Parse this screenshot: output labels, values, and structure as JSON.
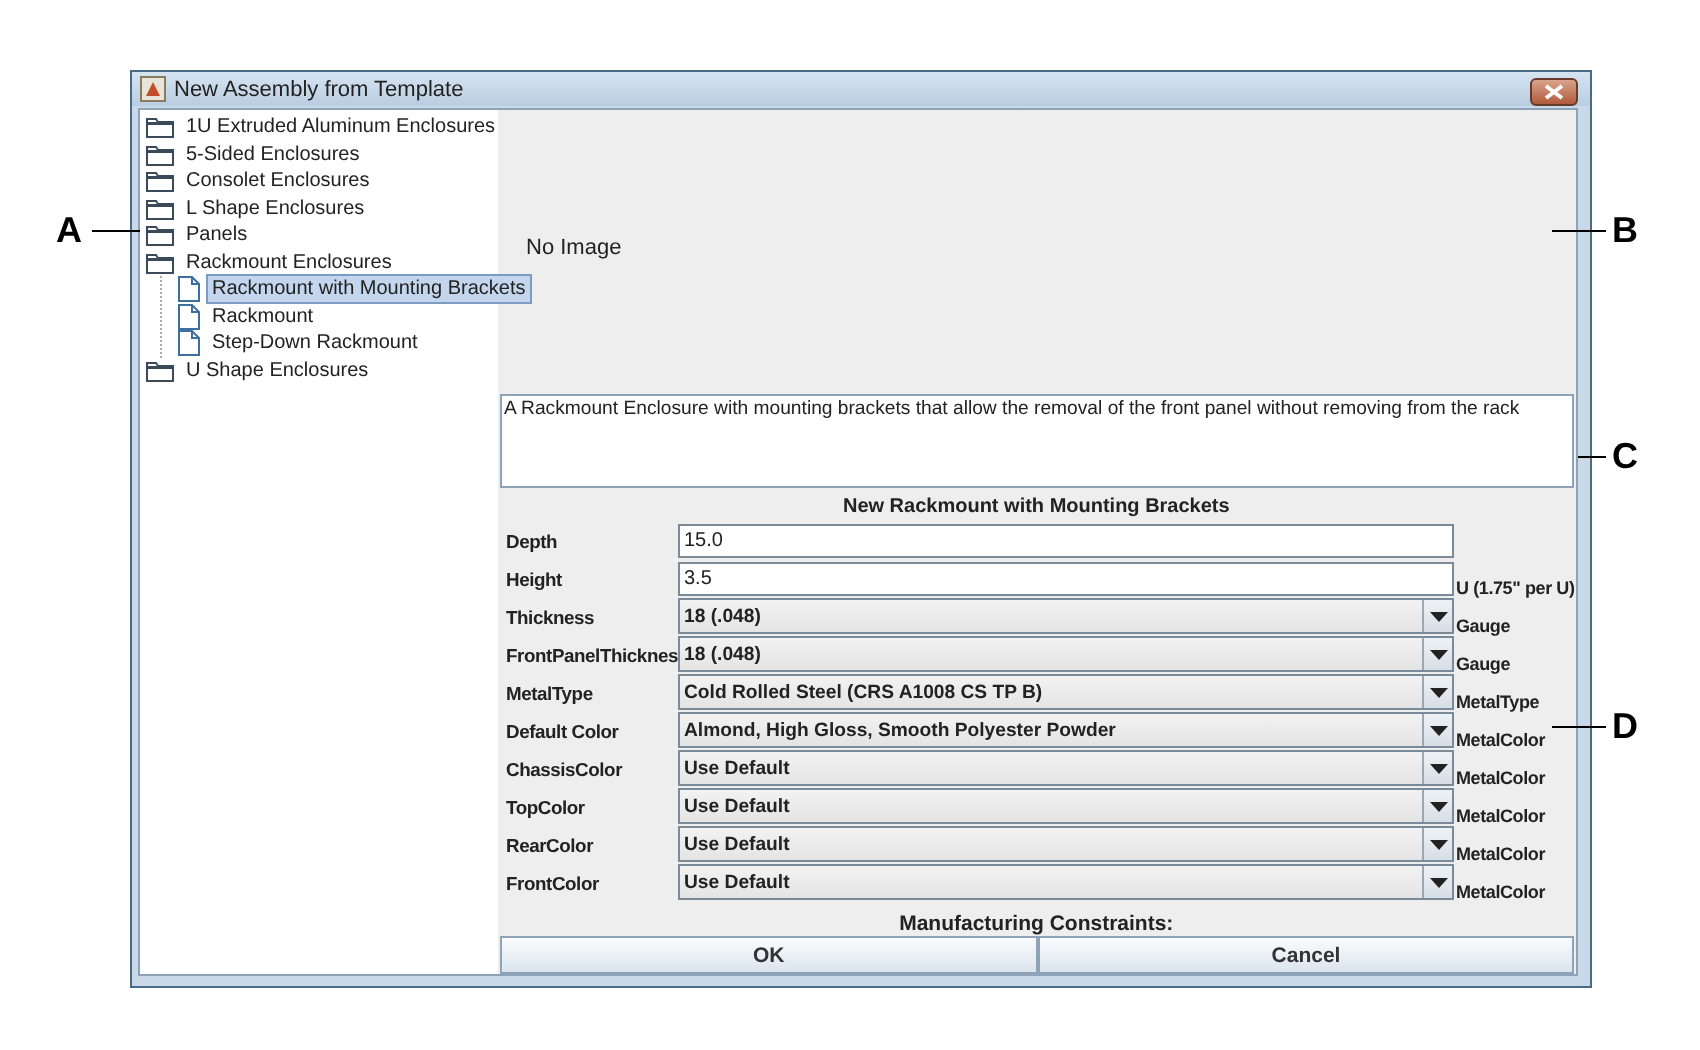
{
  "window": {
    "title": "New Assembly from Template"
  },
  "tree": [
    {
      "label": "1U Extruded Aluminum Enclosures",
      "kind": "folder",
      "selected": false
    },
    {
      "label": "5-Sided Enclosures",
      "kind": "folder",
      "selected": false
    },
    {
      "label": "Consolet Enclosures",
      "kind": "folder",
      "selected": false
    },
    {
      "label": "L Shape Enclosures",
      "kind": "folder",
      "selected": false
    },
    {
      "label": "Panels",
      "kind": "folder",
      "selected": false
    },
    {
      "label": "Rackmount Enclosures",
      "kind": "folder",
      "selected": false,
      "children": [
        {
          "label": "Rackmount with Mounting Brackets",
          "kind": "file",
          "selected": true
        },
        {
          "label": "Rackmount",
          "kind": "file",
          "selected": false
        },
        {
          "label": "Step-Down Rackmount",
          "kind": "file",
          "selected": false
        }
      ]
    },
    {
      "label": "U Shape Enclosures",
      "kind": "folder",
      "selected": false
    }
  ],
  "preview": {
    "text": "No Image"
  },
  "description": "A Rackmount Enclosure with mounting brackets that allow the removal of the front panel without removing from the rack",
  "form": {
    "title": "New Rackmount with Mounting Brackets",
    "fields": [
      {
        "label": "Depth",
        "kind": "text",
        "value": "15.0"
      },
      {
        "label": "Height",
        "kind": "text",
        "value": "3.5",
        "suffix": "U (1.75\" per U)"
      },
      {
        "label": "Thickness",
        "kind": "combo",
        "value": "18 (.048)",
        "suffix": "Gauge"
      },
      {
        "label": "FrontPanelThicknes",
        "kind": "combo",
        "value": "18 (.048)",
        "suffix": "Gauge"
      },
      {
        "label": "MetalType",
        "kind": "combo",
        "value": "Cold Rolled Steel (CRS A1008 CS TP B)",
        "suffix": "MetalType"
      },
      {
        "label": "Default Color",
        "kind": "combo",
        "value": "Almond, High Gloss, Smooth Polyester Powder",
        "suffix": "MetalColor"
      },
      {
        "label": "ChassisColor",
        "kind": "combo",
        "value": "Use Default",
        "suffix": "MetalColor"
      },
      {
        "label": "TopColor",
        "kind": "combo",
        "value": "Use Default",
        "suffix": "MetalColor"
      },
      {
        "label": "RearColor",
        "kind": "combo",
        "value": "Use Default",
        "suffix": "MetalColor"
      },
      {
        "label": "FrontColor",
        "kind": "combo",
        "value": "Use Default",
        "suffix": "MetalColor"
      }
    ]
  },
  "constraints_label": "Manufacturing Constraints:",
  "buttons": [
    "OK",
    "Cancel"
  ],
  "callouts": [
    {
      "letter": "A"
    },
    {
      "letter": "B"
    },
    {
      "letter": "C"
    },
    {
      "letter": "D"
    }
  ]
}
